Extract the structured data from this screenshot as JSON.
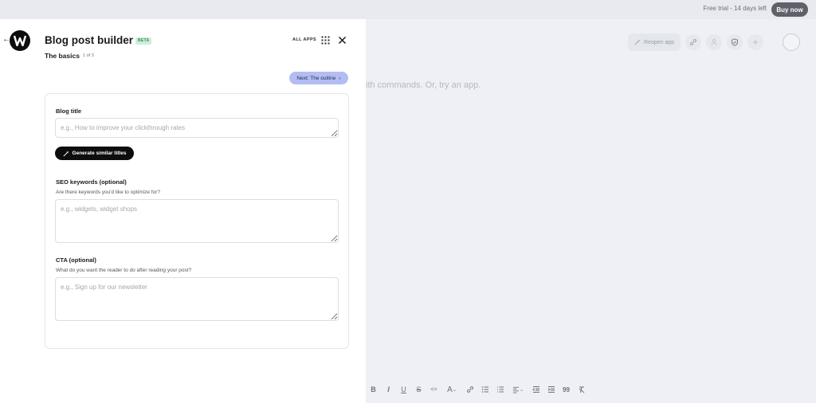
{
  "topbar": {
    "trial_text": "Free trial - 14 days left",
    "buy_label": "Buy now"
  },
  "editor": {
    "reopen_label": "Reopen app",
    "hint_text": "ith commands. Or, try an app.",
    "format_toolbar": [
      {
        "name": "bold-icon",
        "glyph": "B"
      },
      {
        "name": "italic-icon",
        "glyph": "I"
      },
      {
        "name": "underline-icon",
        "glyph": "U"
      },
      {
        "name": "strikethrough-icon",
        "glyph": "S"
      },
      {
        "name": "code-icon",
        "glyph": "<>"
      },
      {
        "name": "font-size-icon",
        "glyph": "A"
      },
      {
        "name": "link-icon",
        "glyph": "link"
      },
      {
        "name": "bullet-list-icon",
        "glyph": "ul"
      },
      {
        "name": "numbered-list-icon",
        "glyph": "ol"
      },
      {
        "name": "align-icon",
        "glyph": "align"
      },
      {
        "name": "outdent-icon",
        "glyph": "outdent"
      },
      {
        "name": "indent-icon",
        "glyph": "indent"
      },
      {
        "name": "quote-icon",
        "glyph": "99"
      },
      {
        "name": "clear-format-icon",
        "glyph": "Tx"
      }
    ]
  },
  "panel": {
    "title": "Blog post builder",
    "badge": "BETA",
    "step_name": "The basics",
    "step_count": "1 of 3",
    "all_apps": "ALL APPS",
    "next_label": "Next: The outline",
    "fields": {
      "blog_title": {
        "label": "Blog title",
        "placeholder": "e.g., How to improve your clickthrough rates"
      },
      "generate_label": "Generate similar titles",
      "seo": {
        "label": "SEO keywords (optional)",
        "help": "Are there keywords you'd like to optimize for?",
        "placeholder": "e.g., widgets, widget shops"
      },
      "cta": {
        "label": "CTA (optional)",
        "help": "What do you want the reader to do after reading your post?",
        "placeholder": "e.g., Sign up for our newsletter"
      }
    }
  },
  "colors": {
    "accent_next": "#b3bdf2",
    "beta_bg": "#cdeedc",
    "beta_text": "#3a8d63",
    "primary_dark": "#0d0d0d"
  }
}
